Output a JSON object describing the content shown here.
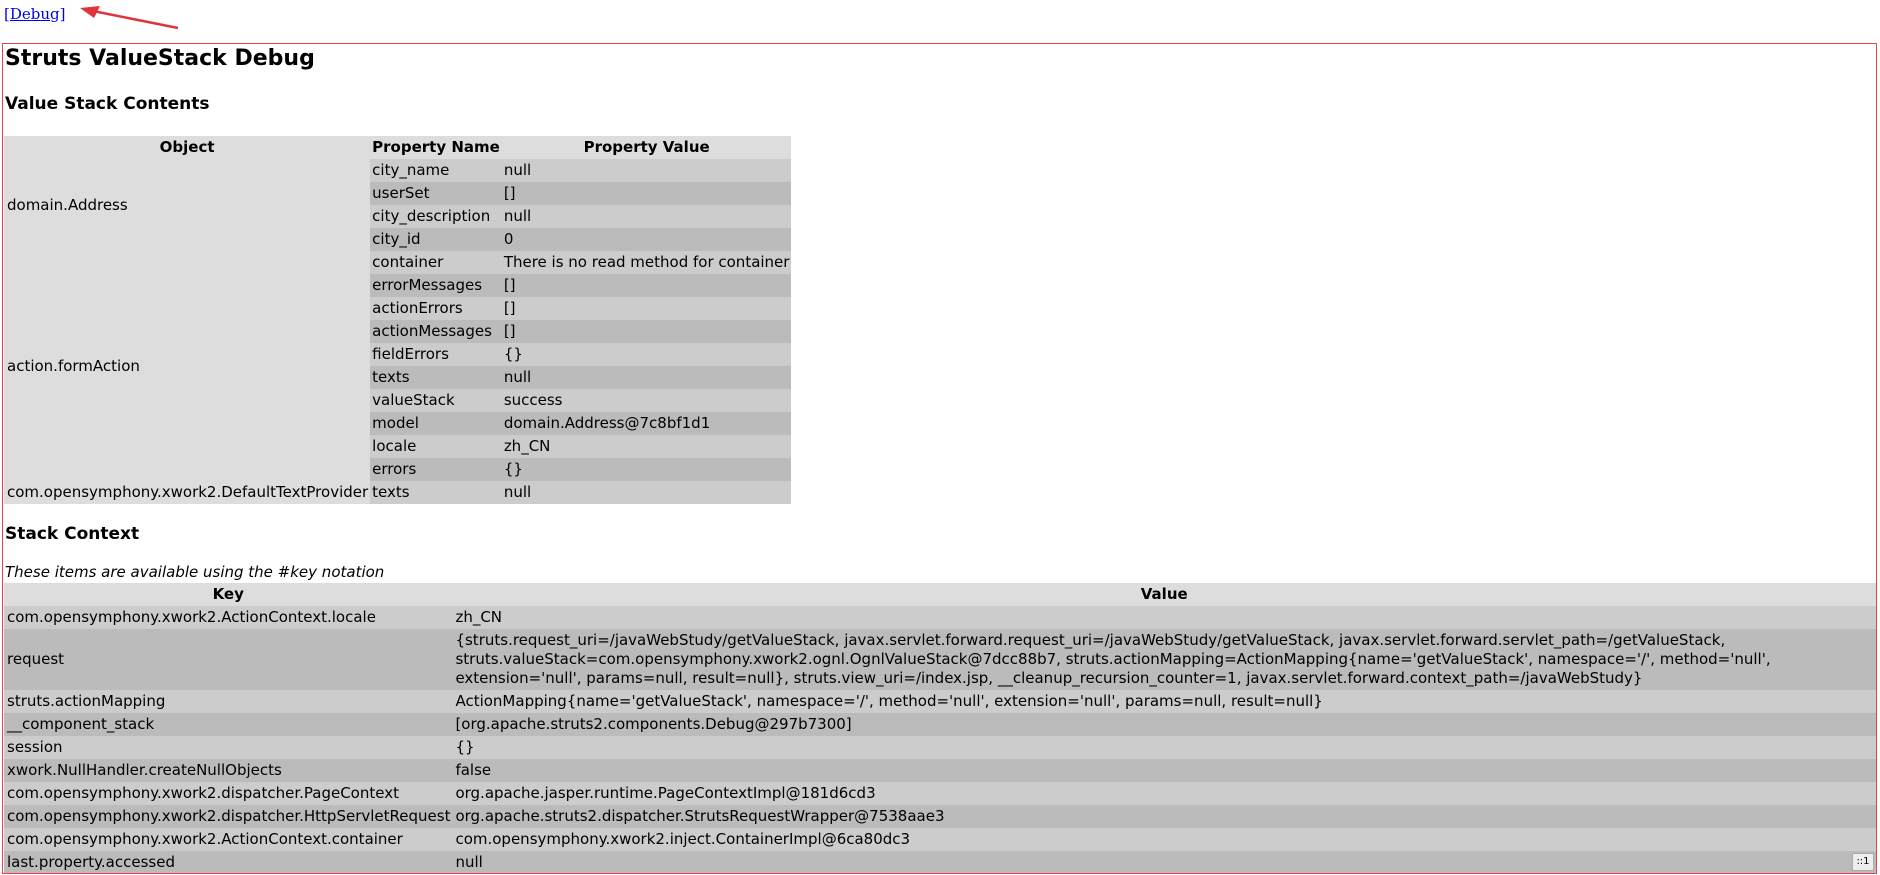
{
  "debug_link": "[Debug]",
  "title": "Struts ValueStack Debug",
  "value_stack": {
    "heading": "Value Stack Contents",
    "headers": {
      "object": "Object",
      "property_name": "Property Name",
      "property_value": "Property Value"
    },
    "objects": [
      {
        "name": "domain.Address",
        "props": [
          {
            "name": "city_name",
            "value": "null"
          },
          {
            "name": "userSet",
            "value": "[]"
          },
          {
            "name": "city_description",
            "value": "null"
          },
          {
            "name": "city_id",
            "value": "0"
          }
        ]
      },
      {
        "name": "action.formAction",
        "props": [
          {
            "name": "container",
            "value": "There is no read method for container"
          },
          {
            "name": "errorMessages",
            "value": "[]"
          },
          {
            "name": "actionErrors",
            "value": "[]"
          },
          {
            "name": "actionMessages",
            "value": "[]"
          },
          {
            "name": "fieldErrors",
            "value": "{}"
          },
          {
            "name": "texts",
            "value": "null"
          },
          {
            "name": "valueStack",
            "value": "success"
          },
          {
            "name": "model",
            "value": "domain.Address@7c8bf1d1"
          },
          {
            "name": "locale",
            "value": "zh_CN"
          },
          {
            "name": "errors",
            "value": "{}"
          }
        ]
      },
      {
        "name": "com.opensymphony.xwork2.DefaultTextProvider",
        "props": [
          {
            "name": "texts",
            "value": "null"
          }
        ]
      }
    ]
  },
  "stack_context": {
    "heading": "Stack Context",
    "note": "These items are available using the #key notation",
    "headers": {
      "key": "Key",
      "value": "Value"
    },
    "rows": [
      {
        "key": "com.opensymphony.xwork2.ActionContext.locale",
        "value": "zh_CN"
      },
      {
        "key": "request",
        "value": "{struts.request_uri=/javaWebStudy/getValueStack, javax.servlet.forward.request_uri=/javaWebStudy/getValueStack, javax.servlet.forward.servlet_path=/getValueStack, struts.valueStack=com.opensymphony.xwork2.ognl.OgnlValueStack@7dcc88b7, struts.actionMapping=ActionMapping{name='getValueStack', namespace='/', method='null', extension='null', params=null, result=null}, struts.view_uri=/index.jsp, __cleanup_recursion_counter=1, javax.servlet.forward.context_path=/javaWebStudy}"
      },
      {
        "key": "struts.actionMapping",
        "value": "ActionMapping{name='getValueStack', namespace='/', method='null', extension='null', params=null, result=null}"
      },
      {
        "key": "__component_stack",
        "value": "[org.apache.struts2.components.Debug@297b7300]"
      },
      {
        "key": "session",
        "value": "{}"
      },
      {
        "key": "xwork.NullHandler.createNullObjects",
        "value": "false"
      },
      {
        "key": "com.opensymphony.xwork2.dispatcher.PageContext",
        "value": "org.apache.jasper.runtime.PageContextImpl@181d6cd3"
      },
      {
        "key": "com.opensymphony.xwork2.dispatcher.HttpServletRequest",
        "value": "org.apache.struts2.dispatcher.StrutsRequestWrapper@7538aae3"
      },
      {
        "key": "com.opensymphony.xwork2.ActionContext.container",
        "value": "com.opensymphony.xwork2.inject.ContainerImpl@6ca80dc3"
      },
      {
        "key": "last.property.accessed",
        "value": "null"
      }
    ]
  },
  "corner_badge": "::1",
  "colors": {
    "box_border": "#e0454a",
    "arrow": "#e0343a",
    "row_light": "#cccccc",
    "row_dark": "#bbbbbb",
    "header_bg": "#dddddd"
  }
}
